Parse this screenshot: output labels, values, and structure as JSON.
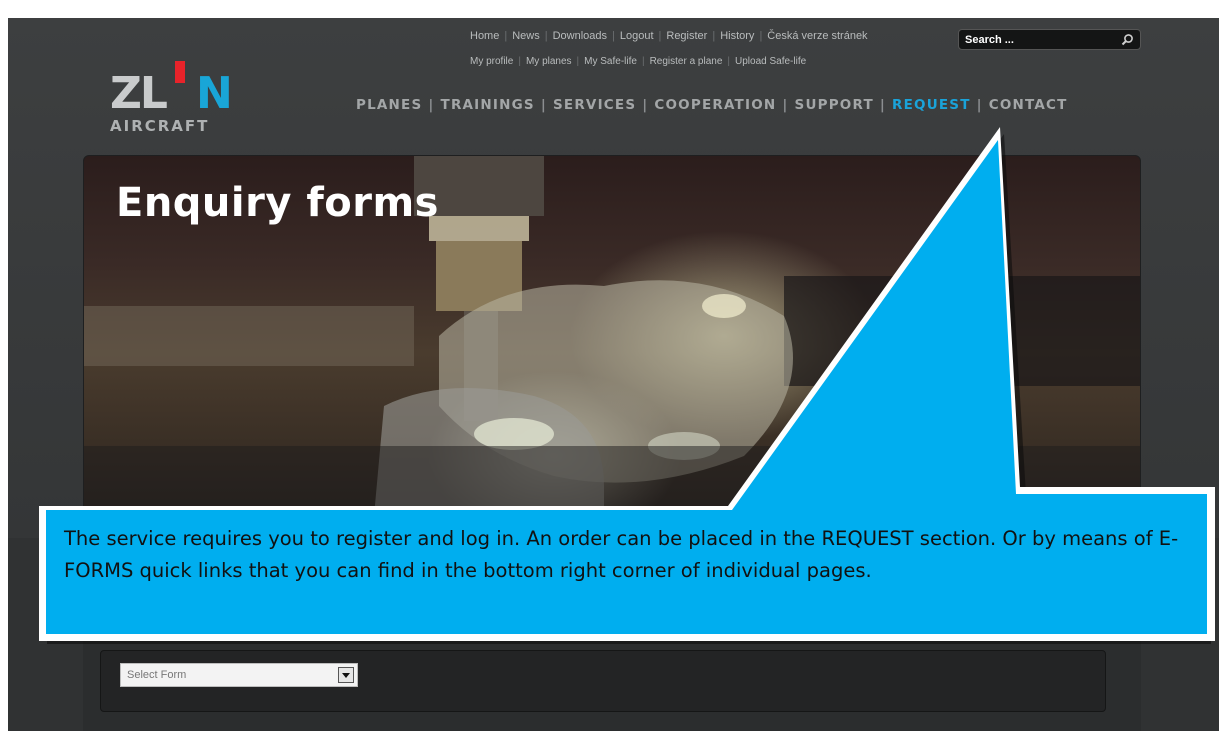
{
  "logo": {
    "main_left": "ZL",
    "main_right": "N",
    "subtitle": "AIRCRAFT"
  },
  "top_links": [
    "Home",
    "News",
    "Downloads",
    "Logout",
    "Register",
    "History",
    "Česká verze stránek"
  ],
  "user_links": [
    "My profile",
    "My planes",
    "My Safe-life",
    "Register a plane",
    "Upload Safe-life"
  ],
  "search": {
    "placeholder": "Search ..."
  },
  "main_nav": [
    {
      "label": "PLANES",
      "active": false
    },
    {
      "label": "TRAININGS",
      "active": false
    },
    {
      "label": "SERVICES",
      "active": false
    },
    {
      "label": "COOPERATION",
      "active": false
    },
    {
      "label": "SUPPORT",
      "active": false
    },
    {
      "label": "REQUEST",
      "active": true
    },
    {
      "label": "CONTACT",
      "active": false
    }
  ],
  "hero": {
    "title": "Enquiry forms"
  },
  "form": {
    "select_value": "Select Form"
  },
  "callout": {
    "text": "The service requires you to register and log in. An order can be placed in the REQUEST section. Or by means of E-FORMS quick links that you can find in the bottom right corner of individual pages."
  },
  "colors": {
    "accent": "#1aa3d9",
    "callout": "#00aeef",
    "logo_bar": "#e8232a"
  }
}
